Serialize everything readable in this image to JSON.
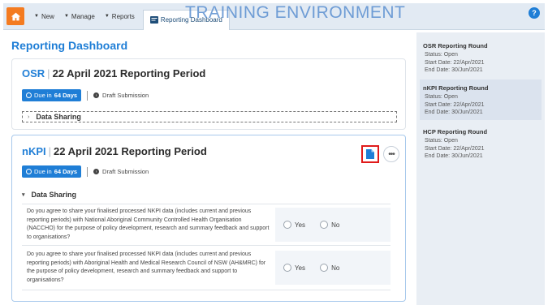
{
  "nav": {
    "items": [
      {
        "label": "New"
      },
      {
        "label": "Manage"
      },
      {
        "label": "Reports"
      }
    ],
    "active": {
      "label": "Reporting Dashboard"
    },
    "watermark": "TRAINING ENVIRONMENT",
    "help": "?"
  },
  "page": {
    "title": "Reporting Dashboard"
  },
  "osr": {
    "code": "OSR",
    "period": "22 April 2021 Reporting Period",
    "due_prefix": "Due in",
    "due_days": "64 Days",
    "status": "Draft Submission",
    "section": "Data Sharing"
  },
  "nkpi": {
    "code": "nKPI",
    "period": "22 April 2021 Reporting Period",
    "due_prefix": "Due in",
    "due_days": "64 Days",
    "status": "Draft Submission",
    "section": "Data Sharing",
    "questions": [
      {
        "text": "Do you agree to share your finalised processed NKPI data (includes current and previous reporting periods) with National Aboriginal Community Controlled Health Organisation (NACCHO) for the purpose of policy development, research and summary feedback and support to organisations?",
        "yes": "Yes",
        "no": "No"
      },
      {
        "text": "Do you agree to share your finalised processed NKPI data (includes current and previous reporting periods) with Aboriginal Health and Medical Research Council of NSW (AH&MRC) for the purpose of policy development, research and summary feedback and support to organisations?",
        "yes": "Yes",
        "no": "No"
      }
    ]
  },
  "rounds": [
    {
      "title": "OSR Reporting Round",
      "status": "Status: Open",
      "start": "Start Date: 22/Apr/2021",
      "end": "End Date: 30/Jun/2021"
    },
    {
      "title": "nKPI Reporting Round",
      "status": "Status: Open",
      "start": "Start Date: 22/Apr/2021",
      "end": "End Date: 30/Jun/2021"
    },
    {
      "title": "HCP Reporting Round",
      "status": "Status: Open",
      "start": "Start Date: 22/Apr/2021",
      "end": "End Date: 30/Jun/2021"
    }
  ],
  "colors": {
    "accent": "#1f7ed6",
    "home": "#f47b20",
    "highlight": "#e01b1b"
  }
}
